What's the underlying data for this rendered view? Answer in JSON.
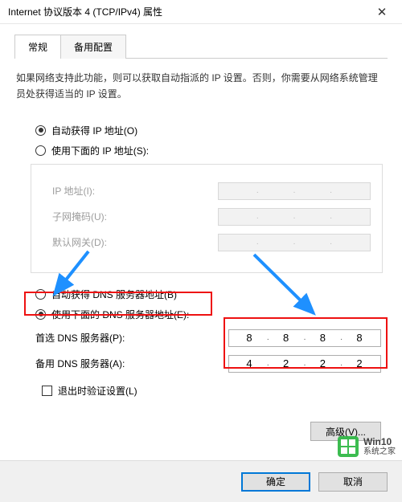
{
  "title": "Internet 协议版本 4 (TCP/IPv4) 属性",
  "tabs": {
    "general": "常规",
    "alternate": "备用配置"
  },
  "description": "如果网络支持此功能，则可以获取自动指派的 IP 设置。否则，你需要从网络系统管理员处获得适当的 IP 设置。",
  "ip_section": {
    "auto": "自动获得 IP 地址(O)",
    "manual": "使用下面的 IP 地址(S):",
    "ip_label": "IP 地址(I):",
    "subnet_label": "子网掩码(U):",
    "gateway_label": "默认网关(D):"
  },
  "dns_section": {
    "auto": "自动获得 DNS 服务器地址(B)",
    "manual": "使用下面的 DNS 服务器地址(E):",
    "preferred_label": "首选 DNS 服务器(P):",
    "alternate_label": "备用 DNS 服务器(A):",
    "preferred": {
      "o1": "8",
      "o2": "8",
      "o3": "8",
      "o4": "8"
    },
    "alternate": {
      "o1": "4",
      "o2": "2",
      "o3": "2",
      "o4": "2"
    }
  },
  "validate_label": "退出时验证设置(L)",
  "advanced_label": "高级(V)...",
  "ok_label": "确定",
  "cancel_label": "取消",
  "watermark": {
    "line1": "Win10",
    "line2": "系统之家"
  },
  "colors": {
    "highlight": "#e11",
    "arrow": "#1e90ff",
    "primary": "#0078d7",
    "brand": "#2cb742"
  }
}
